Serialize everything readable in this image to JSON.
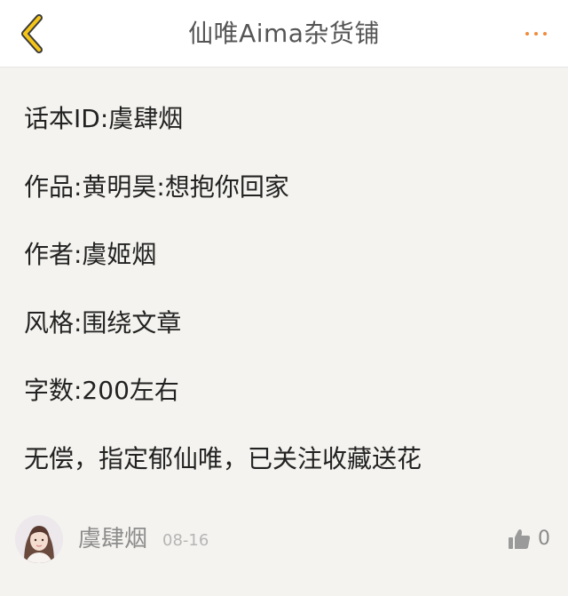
{
  "header": {
    "title": "仙唯Aima杂货铺",
    "back_icon": "chevron-left-icon",
    "more_icon": "more-dots-icon",
    "accent_color": "#f5a623"
  },
  "post": {
    "lines": [
      "话本ID:虞肆烟",
      "作品:黄明昊:想抱你回家",
      "作者:虞姬烟",
      "风格:围绕文章",
      "字数:200左右",
      "无偿，指定郁仙唯，已关注收藏送花"
    ]
  },
  "footer": {
    "author_name": "虞肆烟",
    "date": "08-16",
    "like_count": "0",
    "like_icon": "thumbs-up-icon"
  }
}
